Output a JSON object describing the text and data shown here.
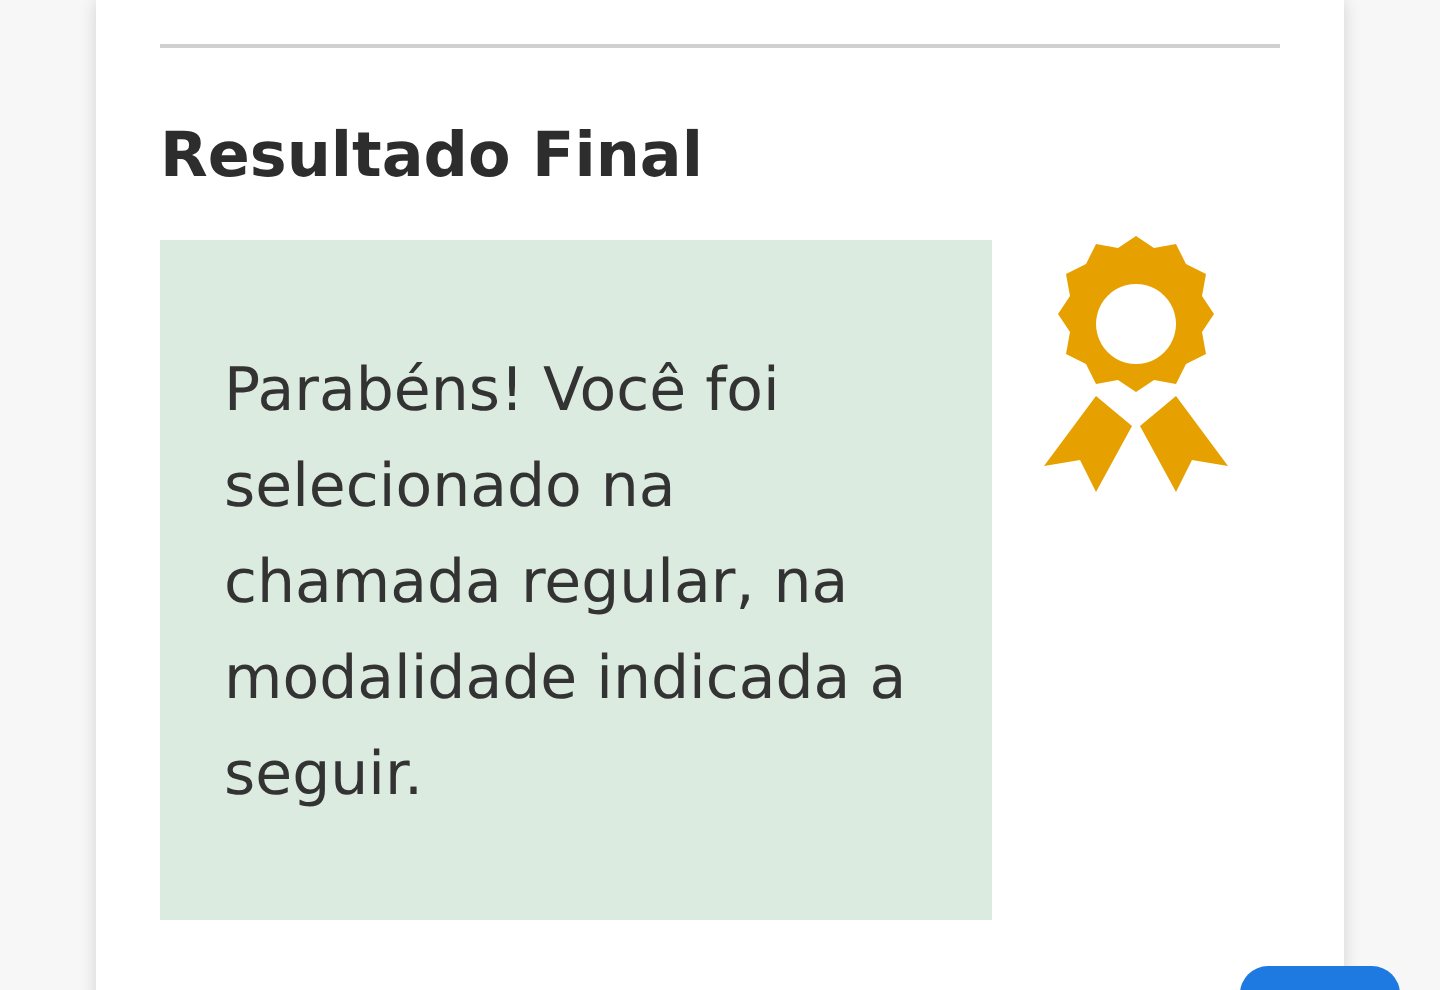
{
  "section": {
    "title": "Resultado Final"
  },
  "message": "Parabéns! Você foi selecionado na chamada regular, na modalidade indicada a seguir."
}
